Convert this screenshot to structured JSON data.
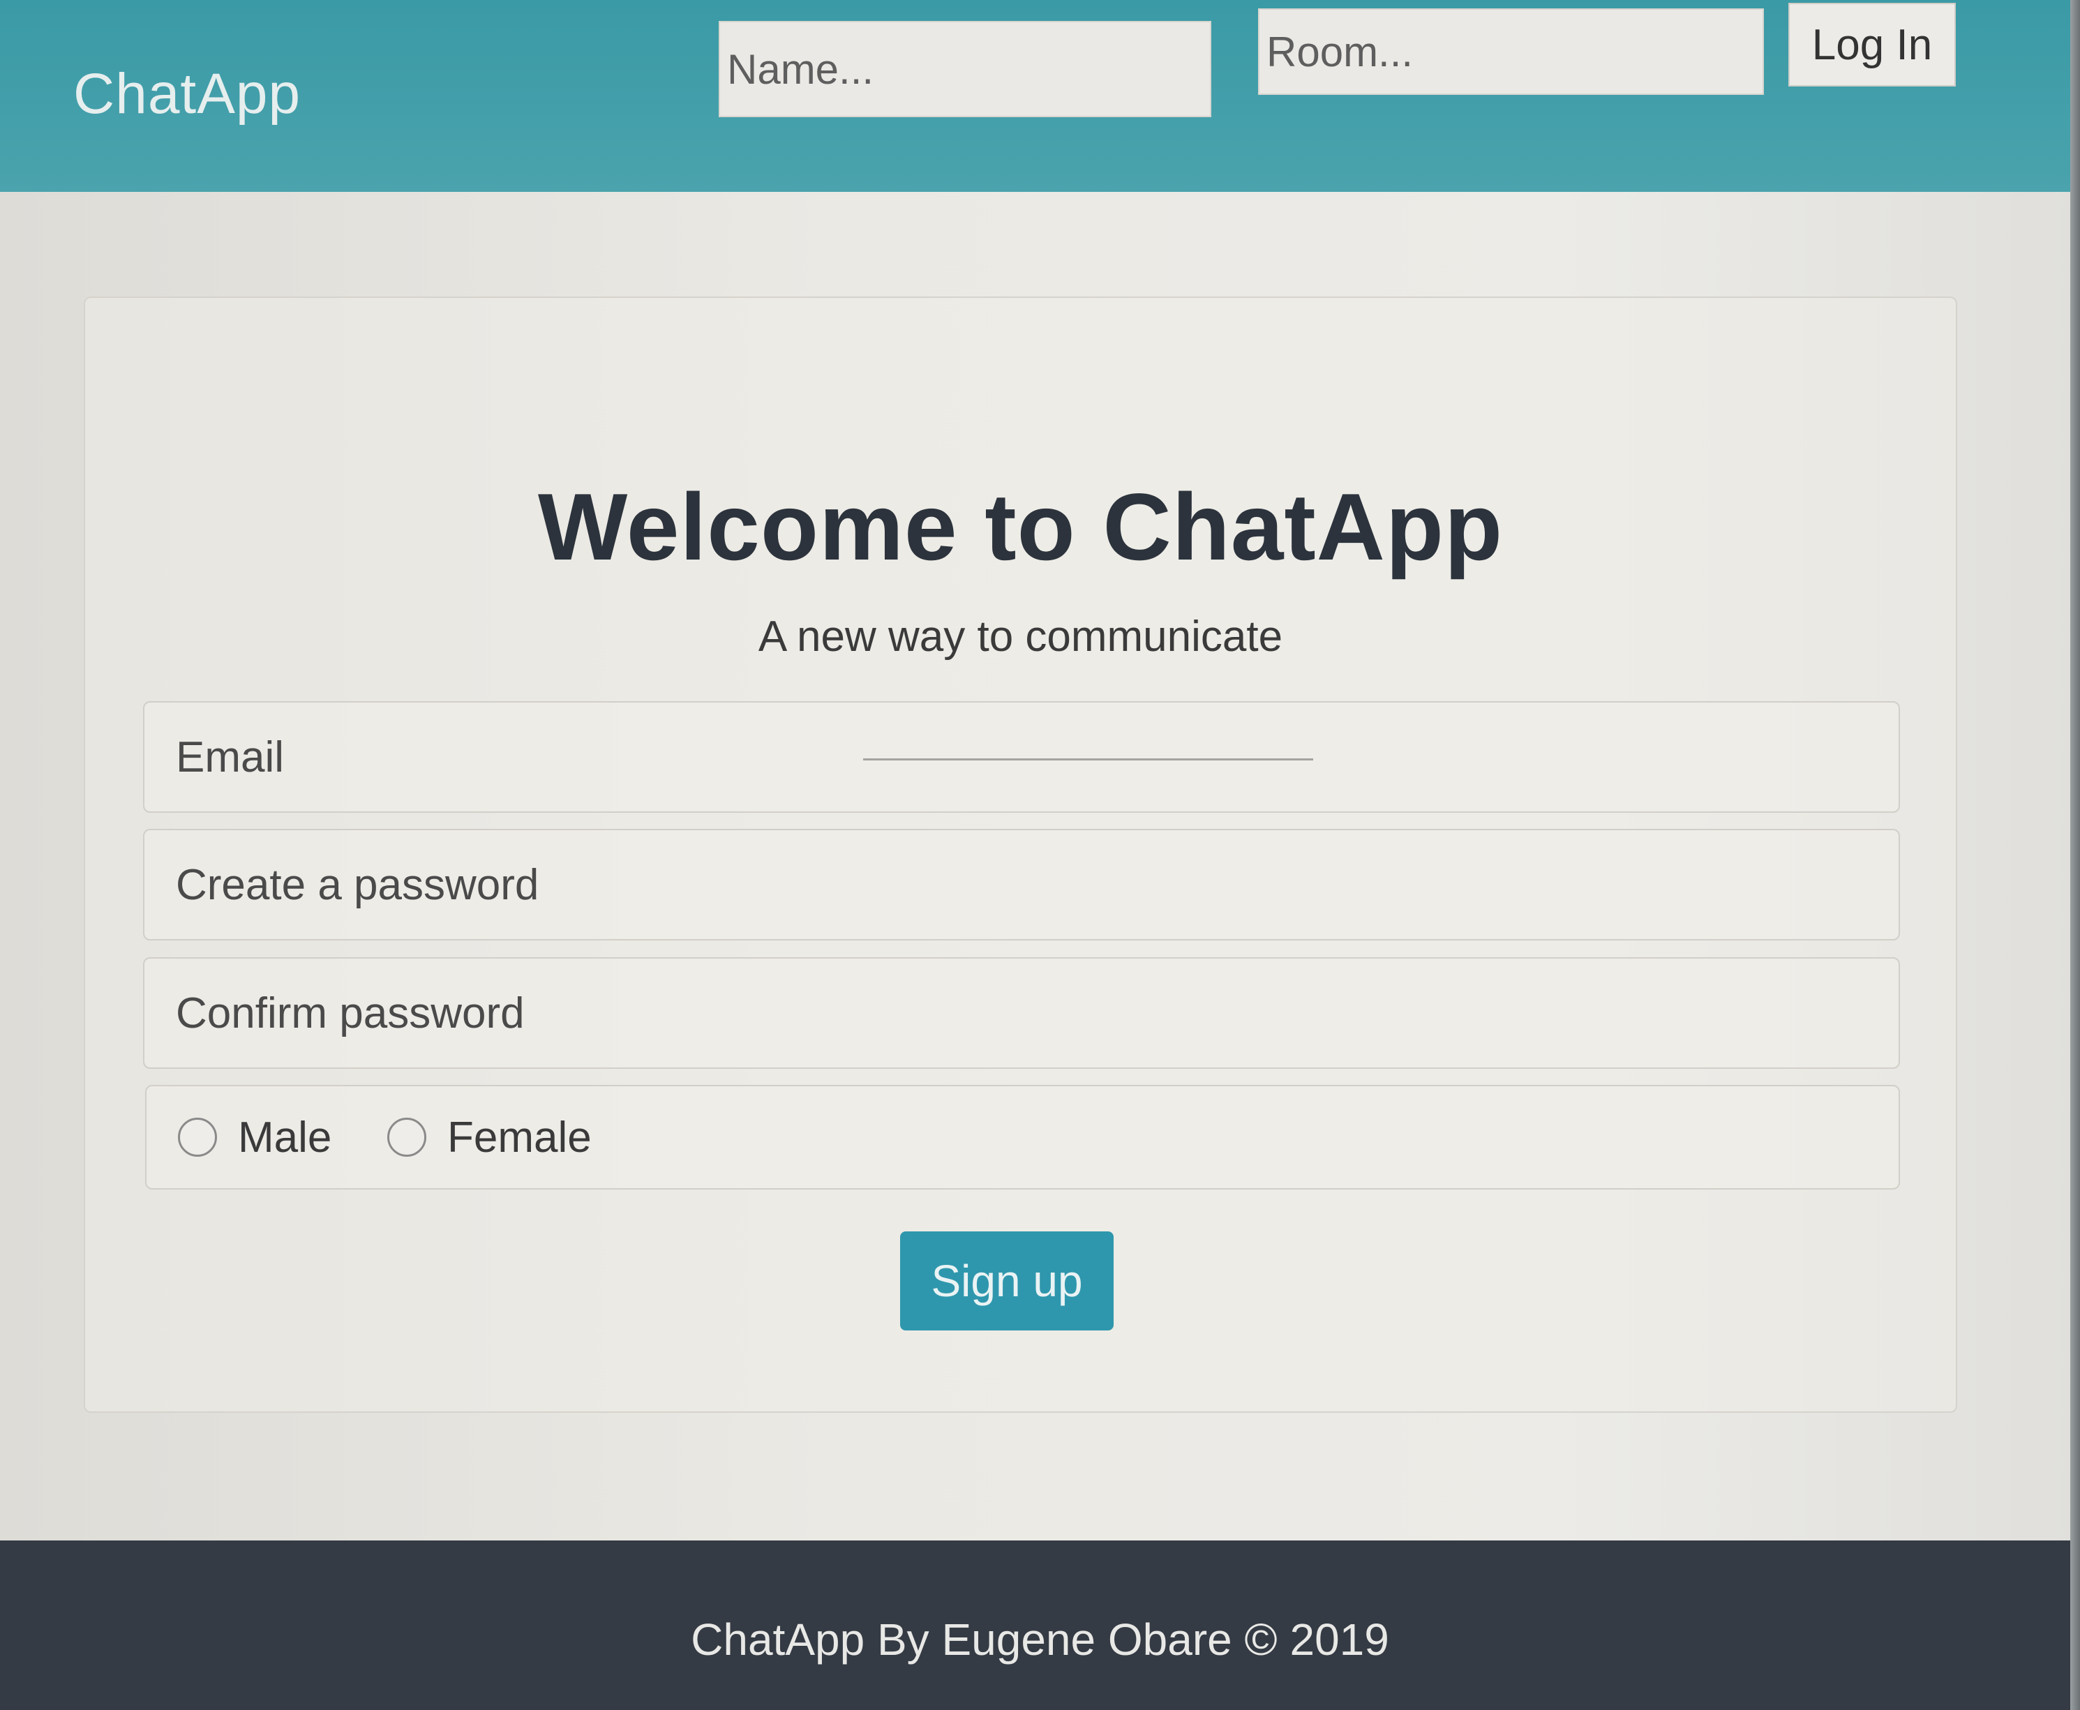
{
  "navbar": {
    "brand": "ChatApp",
    "name_placeholder": "Name...",
    "room_placeholder": "Room...",
    "login_label": "Log In"
  },
  "welcome": {
    "title": "Welcome to ChatApp",
    "subtitle": "A new way to communicate"
  },
  "form": {
    "email_placeholder": "Email",
    "password_placeholder": "Create a password",
    "confirm_placeholder": "Confirm password",
    "gender_options": [
      "Male",
      "Female"
    ],
    "submit_label": "Sign up"
  },
  "footer": {
    "text": "ChatApp By Eugene Obare © 2019"
  },
  "colors": {
    "navbar": "#3a9aa6",
    "accent_button": "#2f97ad",
    "footer": "#353b44",
    "heading": "#2c333c"
  }
}
